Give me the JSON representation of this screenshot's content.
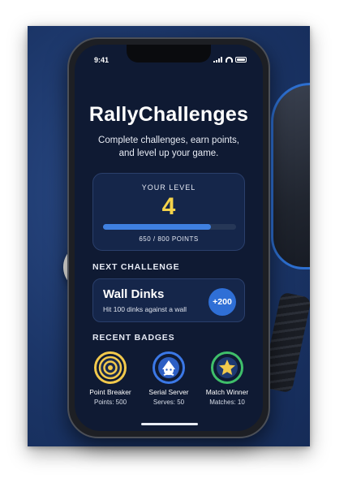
{
  "status_bar": {
    "time": "9:41"
  },
  "app": {
    "title": "RallyChallenges",
    "subtitle": "Complete challenges, earn points, and level up your game."
  },
  "level": {
    "label": "YOUR LEVEL",
    "value": "4",
    "points": "650 / 800 POINTS",
    "progress_fraction": 0.8125
  },
  "next_challenge": {
    "heading": "NEXT CHALLENGE",
    "name": "Wall Dinks",
    "description": "Hit 100 dinks against a wall",
    "points": "+200"
  },
  "badges": {
    "heading": "RECENT BADGES",
    "items": [
      {
        "name": "Point Breaker",
        "stat": "Points: 500",
        "icon": "target-icon",
        "color": "#f2c94c"
      },
      {
        "name": "Serial Server",
        "stat": "Serves: 50",
        "icon": "server-emblem-icon",
        "color": "#3b78e7"
      },
      {
        "name": "Match Winner",
        "stat": "Matches: 10",
        "icon": "star-icon",
        "color": "#3fbf6a"
      }
    ]
  },
  "colors": {
    "background": "#1b3567",
    "screen": "#0f1a33",
    "card": "#15264a",
    "accent_yellow": "#f5d34a",
    "accent_blue": "#3f80e0"
  }
}
